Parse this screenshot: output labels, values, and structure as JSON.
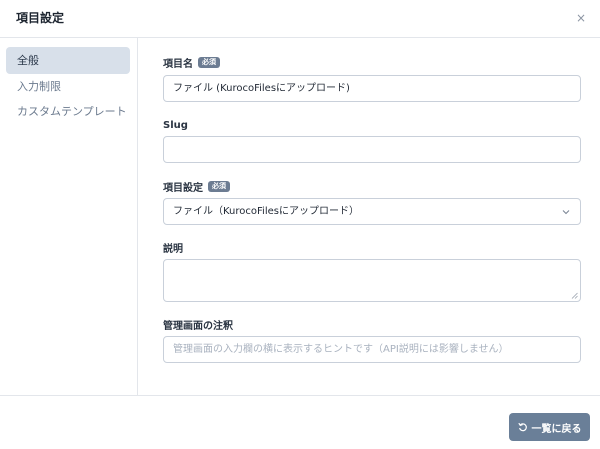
{
  "dialog": {
    "title": "項目設定",
    "close_glyph": "×"
  },
  "sidebar": {
    "items": [
      {
        "label": "全般",
        "active": true
      },
      {
        "label": "入力制限",
        "active": false
      },
      {
        "label": "カスタムテンプレート",
        "active": false
      }
    ]
  },
  "form": {
    "item_name": {
      "label": "項目名",
      "badge": "必須",
      "value": "ファイル (KurocoFilesにアップロード)"
    },
    "slug": {
      "label": "Slug",
      "value": ""
    },
    "item_setting": {
      "label": "項目設定",
      "badge": "必須",
      "selected": "ファイル（KurocoFilesにアップロード）"
    },
    "description": {
      "label": "説明",
      "value": ""
    },
    "admin_note": {
      "label": "管理画面の注釈",
      "placeholder": "管理画面の入力欄の横に表示するヒントです（API説明には影響しません）"
    }
  },
  "footer": {
    "back_button": "一覧に戻る"
  },
  "icons": {
    "close": "close-icon",
    "chevron": "chevron-down-icon",
    "back": "undo-icon",
    "resize": "resize-grip-icon"
  },
  "colors": {
    "primary_button": "#6a7f98",
    "badge": "#6c7c92",
    "sidebar_active": "#d8e0ea"
  }
}
